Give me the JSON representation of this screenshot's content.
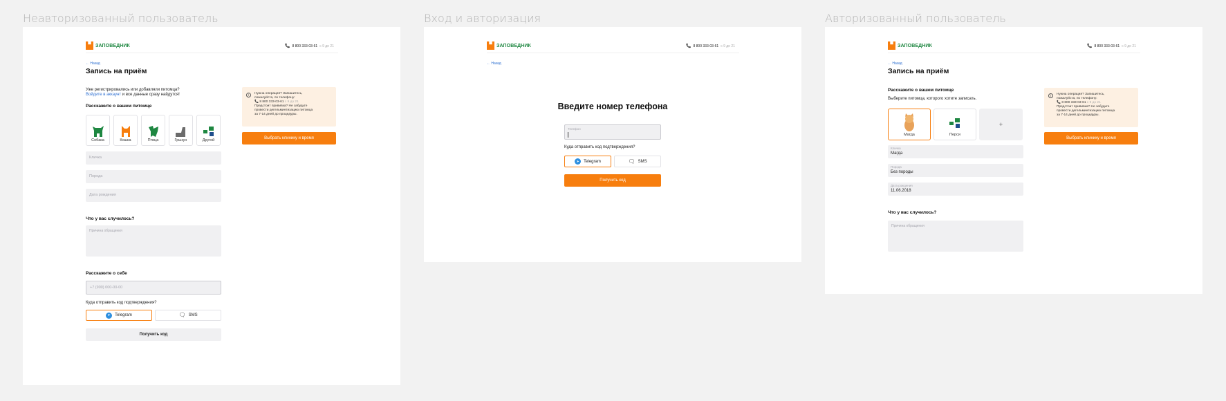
{
  "frames": {
    "unauth": "Неавторизованный пользователь",
    "login": "Вход и авторизация",
    "auth": "Авторизованный пользователь"
  },
  "header": {
    "logo_text": "ЗАПОВЕДНИК",
    "phone": "8 800 333-03-61",
    "hours": "с 9 до 21"
  },
  "back_label": "← Назад",
  "page_title": "Запись на приём",
  "unauth": {
    "login_hint_1": "Уже регистрировались или добавляли питомца?",
    "login_link": "Войдите в аккаунт",
    "login_hint_2": " и все данные сразу найдутся!",
    "pet_heading": "Расскажите о вашем питомце",
    "pets": [
      {
        "label": "Собака",
        "icon": "dog-icon",
        "color": "#1e8741"
      },
      {
        "label": "Кошка",
        "icon": "cat-icon",
        "color": "#f77e0e"
      },
      {
        "label": "Птица",
        "icon": "bird-icon",
        "color": "#1e8741"
      },
      {
        "label": "Грызун",
        "icon": "rodent-icon",
        "color": "#6b6b6b"
      },
      {
        "label": "Другой",
        "icon": "other-pet-icon",
        "color": "#1e8741"
      }
    ],
    "nickname_placeholder": "Кличка",
    "breed_placeholder": "Порода",
    "birth_placeholder": "Дата рождения",
    "problem_heading": "Что у вас случилось?",
    "reason_placeholder": "Причина обращения",
    "self_heading": "Расскажите о себе",
    "phone_placeholder": "+7 (900) 000-00-00",
    "code_question": "Куда отправить код подтверждения?",
    "telegram": "Telegram",
    "sms": "SMS",
    "get_code": "Получить код"
  },
  "note": {
    "line1": "Нужна операция? Запишитесь,",
    "line2": "пожалуйста, по телефону:",
    "phone": "8 800 333-03-61",
    "hours": "с 9 до 21",
    "line3": "Предстоит прививка? Не забудьте",
    "line4": "провести дегельминтизацию питомца",
    "line5": "за 7-14 дней до процедуры.",
    "button": "Выбрать клинику и время"
  },
  "login": {
    "title": "Введите номер телефона",
    "phone_label": "Телефон",
    "code_question": "Куда отправить код подтверждения?",
    "telegram": "Telegram",
    "sms": "SMS",
    "get_code": "Получить код"
  },
  "auth": {
    "pet_heading": "Расскажите о вашем питомце",
    "pet_sub": "Выберите питомца, которого хотите записать.",
    "pets": [
      {
        "label": "Магда",
        "selected": true
      },
      {
        "label": "Перси",
        "selected": false
      }
    ],
    "add_label": "+",
    "nickname_label": "Кличка",
    "nickname_value": "Магда",
    "breed_label": "Порода",
    "breed_value": "Без породы",
    "birth_label": "Дата рождения",
    "birth_value": "11.06.2018",
    "problem_heading": "Что у вас случилось?",
    "reason_placeholder": "Причина обращения"
  },
  "colors": {
    "accent": "#f77e0e",
    "brand_green": "#1e8741",
    "link": "#2d6fd1",
    "note_bg": "#fdf0e2"
  }
}
